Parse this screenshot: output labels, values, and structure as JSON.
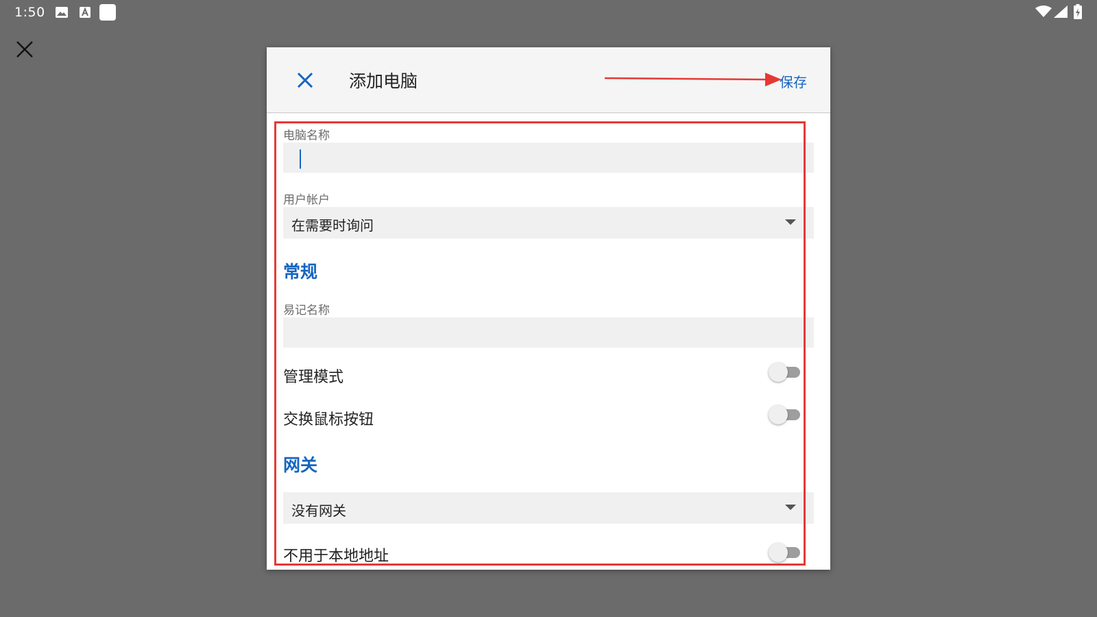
{
  "status_bar": {
    "time": "1:50"
  },
  "dialog": {
    "title": "添加电脑",
    "save_label": "保存"
  },
  "form": {
    "pc_name": {
      "label": "电脑名称",
      "value": ""
    },
    "user_account": {
      "label": "用户帐户",
      "selected": "在需要时询问"
    },
    "general_section": "常规",
    "friendly_name": {
      "label": "易记名称",
      "value": ""
    },
    "admin_mode": {
      "label": "管理模式",
      "on": false
    },
    "swap_mouse": {
      "label": "交换鼠标按钮",
      "on": false
    },
    "gateway_section": "网关",
    "gateway": {
      "selected": "没有网关"
    },
    "bypass_local": {
      "label": "不用于本地地址",
      "on": false
    }
  },
  "colors": {
    "accent": "#1565c0",
    "annotation": "#e53935",
    "backdrop": "#6b6b6b"
  }
}
